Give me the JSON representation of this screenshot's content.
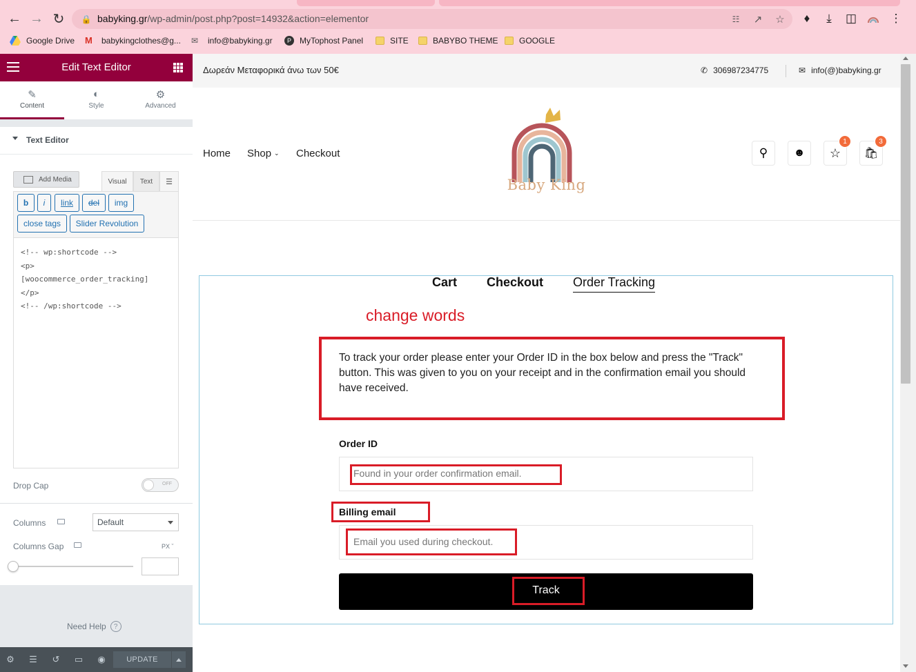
{
  "browser": {
    "url_host": "babyking.gr",
    "url_path": "/wp-admin/post.php?post=14932&action=elementor",
    "bookmarks": [
      {
        "label": "Google Drive",
        "icon": "google-drive-icon"
      },
      {
        "label": "babykingclothes@g...",
        "icon": "gmail-icon"
      },
      {
        "label": "info@babyking.gr",
        "icon": "mail-icon"
      },
      {
        "label": "MyTophost Panel",
        "icon": "mytophost-icon"
      },
      {
        "label": "SITE",
        "icon": "folder-icon"
      },
      {
        "label": "BABYBO THEME",
        "icon": "folder-icon"
      },
      {
        "label": "GOOGLE",
        "icon": "folder-icon"
      }
    ]
  },
  "editor": {
    "title": "Edit Text Editor",
    "tabs": [
      "Content",
      "Style",
      "Advanced"
    ],
    "section": "Text Editor",
    "add_media": "Add Media",
    "mode_tabs": [
      "Visual",
      "Text"
    ],
    "quicktags": [
      "b",
      "i",
      "link",
      "del",
      "img",
      "close tags",
      "Slider Revolution"
    ],
    "code": "<!-- wp:shortcode -->\n<p>\n[woocommerce_order_tracking]\n</p>\n<!-- /wp:shortcode -->",
    "drop_cap_label": "Drop Cap",
    "drop_cap_state": "OFF",
    "columns_label": "Columns",
    "columns_value": "Default",
    "columns_gap_label": "Columns Gap",
    "columns_gap_unit": "PX",
    "need_help": "Need Help",
    "update_label": "UPDATE"
  },
  "site": {
    "shipping_note": "Δωρεάν Μεταφορικά άνω των 50€",
    "phone": "306987234775",
    "email": "info(@)babyking.gr",
    "nav": [
      "Home",
      "Shop",
      "Checkout"
    ],
    "logo_text": "Baby King",
    "wishlist_count": "1",
    "cart_count": "3",
    "steps": [
      "Cart",
      "Checkout",
      "Order Tracking"
    ],
    "annotation": "change words",
    "description": "To track your order please enter your Order ID in the box below and press the \"Track\" button. This was given to you on your receipt and in the confirmation email you should have received.",
    "order_id_label": "Order ID",
    "order_id_placeholder": "Found in your order confirmation email.",
    "billing_email_label": "Billing email",
    "billing_email_placeholder": "Email you used during checkout.",
    "track_label": "Track"
  },
  "colors": {
    "elementor_accent": "#93003c",
    "annotation_red": "#d91c27",
    "badge_orange": "#f26b3a",
    "browser_pink": "#fbd3dc"
  }
}
